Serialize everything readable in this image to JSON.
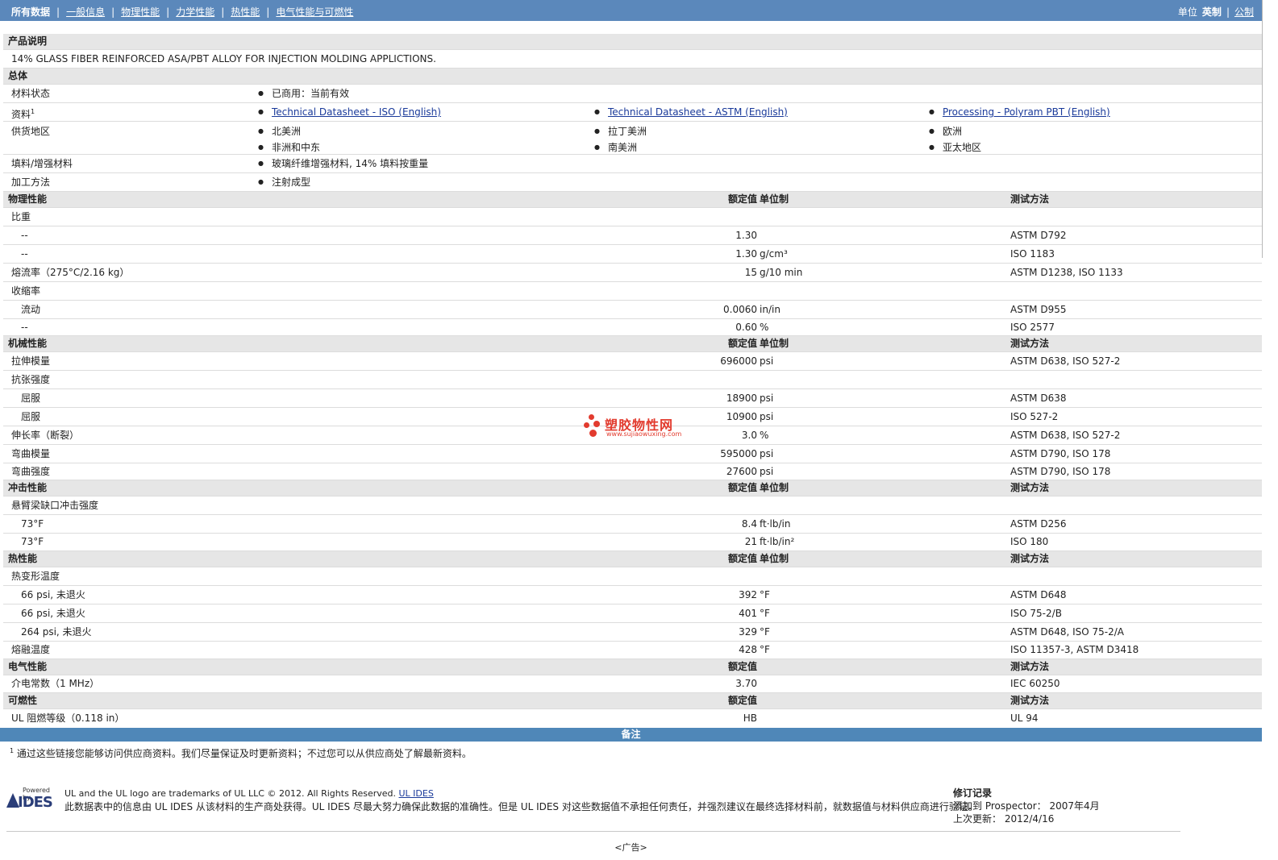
{
  "nav": {
    "tabs": [
      "所有数据",
      "一般信息",
      "物理性能",
      "力学性能",
      "热性能",
      "电气性能与可燃性"
    ],
    "unit_label": "单位",
    "unit_current": "英制",
    "unit_alt": "公制"
  },
  "product_desc": {
    "title": "产品说明",
    "text": "14% GLASS FIBER REINFORCED ASA/PBT ALLOY FOR INJECTION MOLDING APPLICTIONS."
  },
  "general": {
    "title": "总体",
    "status_label": "材料状态",
    "status": "已商用：当前有效",
    "docs_label": "资料",
    "docs_sup": "1",
    "docs": [
      "Technical Datasheet - ISO (English)",
      "Technical Datasheet - ASTM (English)",
      "Processing - Polyram PBT (English)"
    ],
    "regions_label": "供货地区",
    "regions": [
      "北美洲",
      "拉丁美洲",
      "欧洲",
      "非洲和中东",
      "南美洲",
      "亚太地区"
    ],
    "filler_label": "填料/增强材料",
    "filler": "玻璃纤维增强材料, 14% 填料按重量",
    "process_label": "加工方法",
    "process": "注射成型"
  },
  "headers": {
    "nominal": "额定值",
    "unit": "单位制",
    "test": "测试方法"
  },
  "sections": {
    "physical": {
      "title": "物理性能",
      "rows": [
        {
          "label": "比重"
        },
        {
          "label": "--",
          "value": "1.30",
          "unit": "",
          "test": "ASTM D792"
        },
        {
          "label": "--",
          "value": "1.30",
          "unit": "g/cm³",
          "test": "ISO 1183"
        },
        {
          "label": "熔流率（275°C/2.16 kg）",
          "value": "15",
          "unit": "g/10 min",
          "test": "ASTM D1238, ISO 1133"
        },
        {
          "label": "收缩率"
        },
        {
          "label": "流动",
          "value": "0.0060",
          "unit": "in/in",
          "test": "ASTM D955"
        },
        {
          "label": "--",
          "value": "0.60",
          "unit": "%",
          "test": "ISO 2577"
        }
      ]
    },
    "mechanical": {
      "title": "机械性能",
      "rows": [
        {
          "label": "拉伸模量",
          "value": "696000",
          "unit": "psi",
          "test": "ASTM D638, ISO 527-2"
        },
        {
          "label": "抗张强度"
        },
        {
          "label": "屈服",
          "value": "18900",
          "unit": "psi",
          "test": "ASTM D638"
        },
        {
          "label": "屈服",
          "value": "10900",
          "unit": "psi",
          "test": "ISO 527-2"
        },
        {
          "label": "伸长率（断裂）",
          "value": "3.0",
          "unit": "%",
          "test": "ASTM D638, ISO 527-2"
        },
        {
          "label": "弯曲模量",
          "value": "595000",
          "unit": "psi",
          "test": "ASTM D790, ISO 178"
        },
        {
          "label": "弯曲强度",
          "value": "27600",
          "unit": "psi",
          "test": "ASTM D790, ISO 178"
        }
      ]
    },
    "impact": {
      "title": "冲击性能",
      "rows": [
        {
          "label": "悬臂梁缺口冲击强度"
        },
        {
          "label": "73°F",
          "value": "8.4",
          "unit": "ft·lb/in",
          "test": "ASTM D256"
        },
        {
          "label": "73°F",
          "value": "21",
          "unit": "ft·lb/in²",
          "test": "ISO 180"
        }
      ]
    },
    "thermal": {
      "title": "热性能",
      "rows": [
        {
          "label": "热变形温度"
        },
        {
          "label": "66 psi, 未退火",
          "value": "392",
          "unit": "°F",
          "test": "ASTM D648"
        },
        {
          "label": "66 psi, 未退火",
          "value": "401",
          "unit": "°F",
          "test": "ISO 75-2/B"
        },
        {
          "label": "264 psi, 未退火",
          "value": "329",
          "unit": "°F",
          "test": "ASTM D648, ISO 75-2/A"
        },
        {
          "label": "熔融温度",
          "value": "428",
          "unit": "°F",
          "test": "ISO 11357-3, ASTM D3418"
        }
      ]
    },
    "electrical": {
      "title": "电气性能",
      "rows": [
        {
          "label": "介电常数（1 MHz）",
          "value": "3.70",
          "unit": "",
          "test": "IEC 60250"
        }
      ]
    },
    "flammability": {
      "title": "可燃性",
      "rows": [
        {
          "label": "UL 阻燃等级（0.118 in）",
          "value": "HB",
          "unit": "",
          "test": "UL 94"
        }
      ]
    }
  },
  "notes": {
    "title": "备注",
    "sup": "1",
    "text": "通过这些链接您能够访问供应商资料。我们尽量保证及时更新资料；不过您可以从供应商处了解最新资料。"
  },
  "footer": {
    "logo_powered": "Powered by",
    "logo_name": "IDES",
    "trademark": "UL and the UL logo are trademarks of UL LLC © 2012. All Rights Reserved.",
    "trademark_link": "UL IDES",
    "disclaimer": "此数据表中的信息由 UL IDES 从该材料的生产商处获得。UL IDES 尽最大努力确保此数据的准确性。但是 UL IDES 对这些数据值不承担任何责任，并强烈建议在最终选择材料前，就数据值与材料供应商进行验证。",
    "rev_title": "修订记录",
    "rev_added": "添加到 Prospector： 2007年4月",
    "rev_updated": "上次更新： 2012/4/16",
    "ad": "<广告>"
  },
  "watermark": {
    "cn": "塑胶物性网",
    "url": "www.sujiaowuxing.com",
    "color": "#e23b2e"
  }
}
